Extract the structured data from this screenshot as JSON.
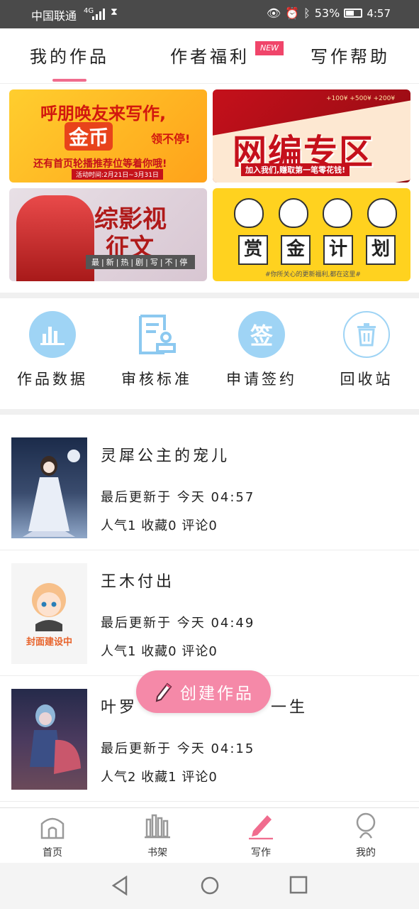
{
  "status": {
    "carrier": "中国联通",
    "signal": "4G",
    "battery": "53%",
    "time": "4:57"
  },
  "tabs": [
    {
      "label": "我的作品"
    },
    {
      "label": "作者福利",
      "badge": "NEW"
    },
    {
      "label": "写作帮助"
    }
  ],
  "banners": {
    "b1": {
      "line1": "呼朋唤友来写作,",
      "line2": "金币",
      "line2b": "领不停!",
      "line3": "还有首页轮播推荐位等着你哦!",
      "line4": "活动时间:2月21日~3月31日"
    },
    "b2": {
      "title": "网编专区",
      "sub": "加入我们,赚取第一笔零花钱!",
      "nums": "+100¥ +500¥ +200¥"
    },
    "b3": {
      "line1": "综影视",
      "line2": "征文",
      "line3": "最|新|热|剧|写|不|停"
    },
    "b4": {
      "chars": [
        "赏",
        "金",
        "计",
        "划"
      ],
      "foot": "#你所关心的更新福利,都在这里#"
    }
  },
  "quick_actions": [
    {
      "label": "作品数据",
      "icon": "bar-chart-icon"
    },
    {
      "label": "审核标准",
      "icon": "document-stamp-icon"
    },
    {
      "label": "申请签约",
      "icon": "sign-icon",
      "glyph": "签"
    },
    {
      "label": "回收站",
      "icon": "trash-icon"
    }
  ],
  "works": [
    {
      "title": "灵犀公主的宠儿",
      "updated": "最后更新于 今天 04:57",
      "stats": "人气1 收藏0 评论0"
    },
    {
      "title": "王木付出",
      "updated": "最后更新于 今天 04:49",
      "stats": "人气1 收藏0 评论0",
      "cover_text": "封面建设中"
    },
    {
      "title": "叶罗",
      "title_tail": "一生",
      "updated": "最后更新于 今天 04:15",
      "stats": "人气2 收藏1 评论0"
    }
  ],
  "fab": {
    "label": "创建作品"
  },
  "bottom_nav": [
    {
      "label": "首页"
    },
    {
      "label": "书架"
    },
    {
      "label": "写作",
      "active": true
    },
    {
      "label": "我的"
    }
  ],
  "colors": {
    "accent": "#f06c8e",
    "fab": "#f589a8",
    "icon_blue": "#9fd4f5"
  }
}
